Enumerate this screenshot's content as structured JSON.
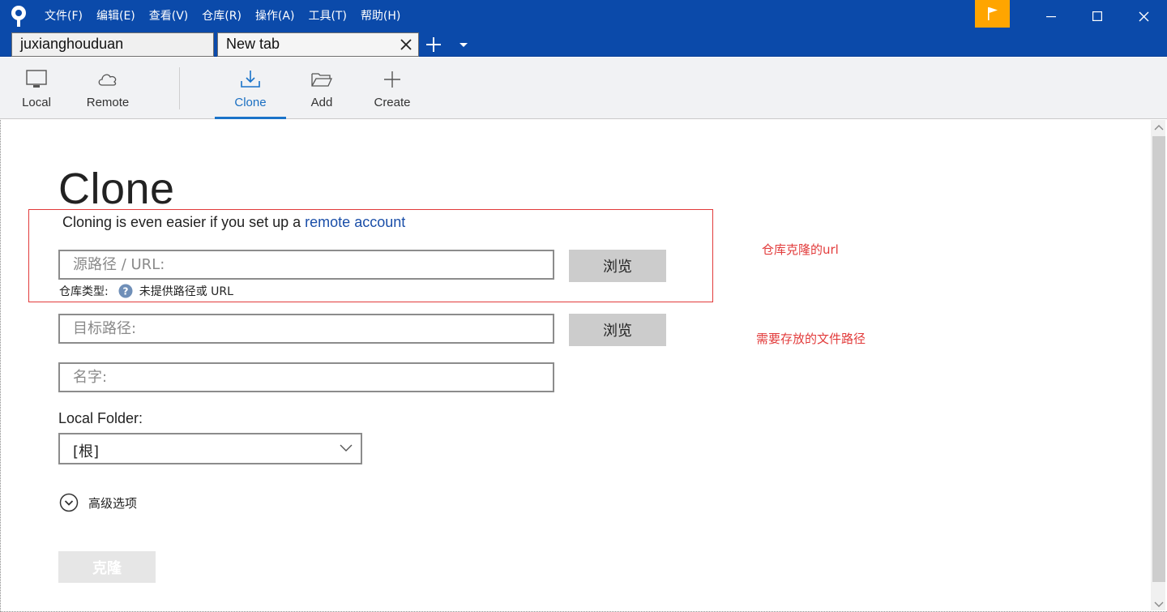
{
  "colors": {
    "titlebar": "#0b4aaa",
    "accent": "#1a73c9",
    "flag": "#ffa500",
    "annotation": "#e23b3b",
    "link": "#1a4ea8"
  },
  "menu": [
    "文件(F)",
    "编辑(E)",
    "查看(V)",
    "仓库(R)",
    "操作(A)",
    "工具(T)",
    "帮助(H)"
  ],
  "tabs": [
    {
      "label": "juxianghouduan"
    },
    {
      "label": "New tab"
    }
  ],
  "toolbar": {
    "local": "Local",
    "remote": "Remote",
    "clone": "Clone",
    "add": "Add",
    "create": "Create"
  },
  "main": {
    "title": "Clone",
    "hint_prefix": "Cloning is even easier if you set up a ",
    "hint_link": "remote account",
    "url_placeholder": "源路径 / URL:",
    "browse_label": "浏览",
    "repo_type_label": "仓库类型:",
    "repo_type_value": "未提供路径或 URL",
    "target_placeholder": "目标路径:",
    "name_placeholder": "名字:",
    "local_folder_label": "Local Folder:",
    "local_folder_value": "[根]",
    "advanced_label": "高级选项",
    "clone_button": "克隆"
  },
  "annotations": {
    "url_note": "仓库克隆的url",
    "path_note": "需要存放的文件路径"
  }
}
